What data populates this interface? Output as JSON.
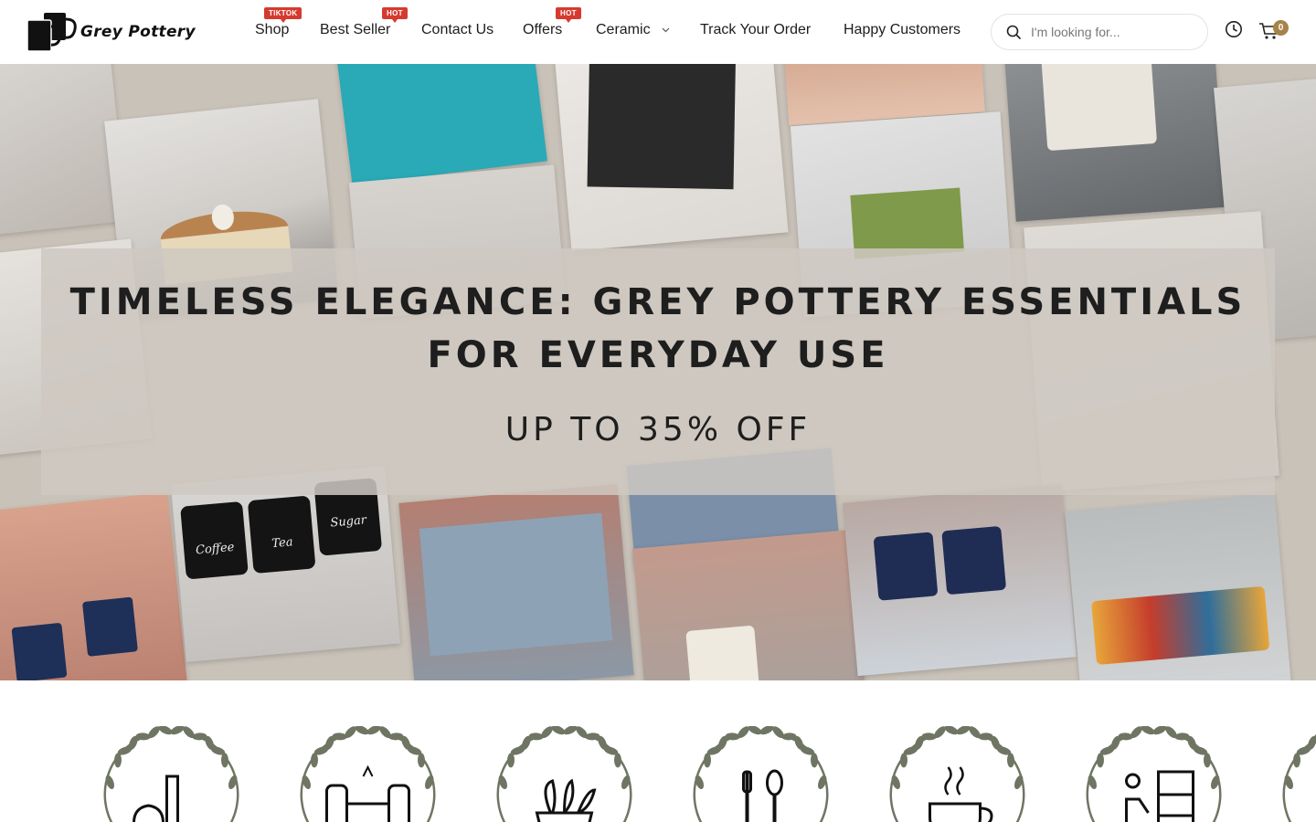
{
  "brand": {
    "name": "Grey Pottery"
  },
  "nav": {
    "items": [
      {
        "label": "Shop",
        "badge": "TIKTOK"
      },
      {
        "label": "Best Seller",
        "badge": "HOT"
      },
      {
        "label": "Contact Us",
        "badge": ""
      },
      {
        "label": "Offers",
        "badge": "HOT"
      },
      {
        "label": "Ceramic",
        "badge": ""
      },
      {
        "label": "Track Your Order",
        "badge": ""
      },
      {
        "label": "Happy Customers",
        "badge": ""
      }
    ]
  },
  "search": {
    "placeholder": "I'm looking for..."
  },
  "cart": {
    "count": "0"
  },
  "hero": {
    "title": "TIMELESS ELEGANCE: GREY POTTERY ESSENTIALS FOR EVERYDAY USE",
    "subtitle": "UP TO 35% OFF",
    "jar_labels": [
      "Coffee",
      "Tea",
      "Sugar"
    ]
  },
  "categories": {
    "icons": [
      "vases-icon",
      "dining-set-icon",
      "planters-icon",
      "cutlery-icon",
      "coffee-cup-icon",
      "home-decor-icon",
      "more-icon"
    ]
  },
  "colors": {
    "badge": "#d63a2f",
    "cart_badge": "#a6834a",
    "hero_bg": "#c9c2b9",
    "wreath": "#6f7563"
  }
}
